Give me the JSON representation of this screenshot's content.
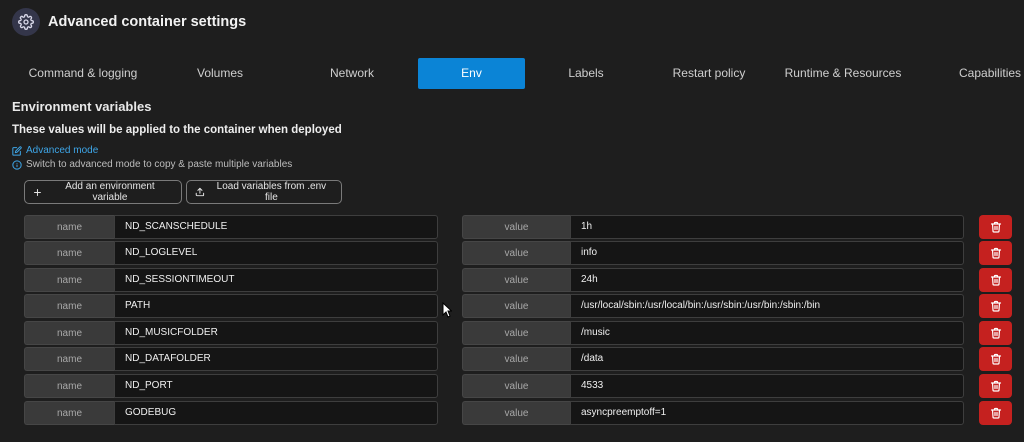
{
  "header": {
    "title": "Advanced container settings",
    "icon": "gear-icon"
  },
  "tabs": [
    {
      "label": "Command & logging",
      "active": false
    },
    {
      "label": "Volumes",
      "active": false
    },
    {
      "label": "Network",
      "active": false
    },
    {
      "label": "Env",
      "active": true
    },
    {
      "label": "Labels",
      "active": false
    },
    {
      "label": "Restart policy",
      "active": false
    },
    {
      "label": "Runtime & Resources",
      "active": false
    },
    {
      "label": "Capabilities",
      "active": false
    }
  ],
  "env": {
    "section_title": "Environment variables",
    "subtitle": "These values will be applied to the container when deployed",
    "advanced_mode_label": "Advanced mode",
    "hint": "Switch to advanced mode to copy & paste multiple variables",
    "add_button": "Add an environment variable",
    "load_button": "Load variables from .env file",
    "name_label": "name",
    "value_label": "value",
    "variables": [
      {
        "name": "ND_SCANSCHEDULE",
        "value": "1h"
      },
      {
        "name": "ND_LOGLEVEL",
        "value": "info"
      },
      {
        "name": "ND_SESSIONTIMEOUT",
        "value": "24h"
      },
      {
        "name": "PATH",
        "value": "/usr/local/sbin:/usr/local/bin:/usr/sbin:/usr/bin:/sbin:/bin"
      },
      {
        "name": "ND_MUSICFOLDER",
        "value": "/music"
      },
      {
        "name": "ND_DATAFOLDER",
        "value": "/data"
      },
      {
        "name": "ND_PORT",
        "value": "4533"
      },
      {
        "name": "GODEBUG",
        "value": "asyncpreemptoff=1"
      }
    ]
  },
  "colors": {
    "accent": "#0b84d6",
    "danger": "#c5211f",
    "link": "#3ea6e8",
    "background": "#1e1e1e"
  }
}
